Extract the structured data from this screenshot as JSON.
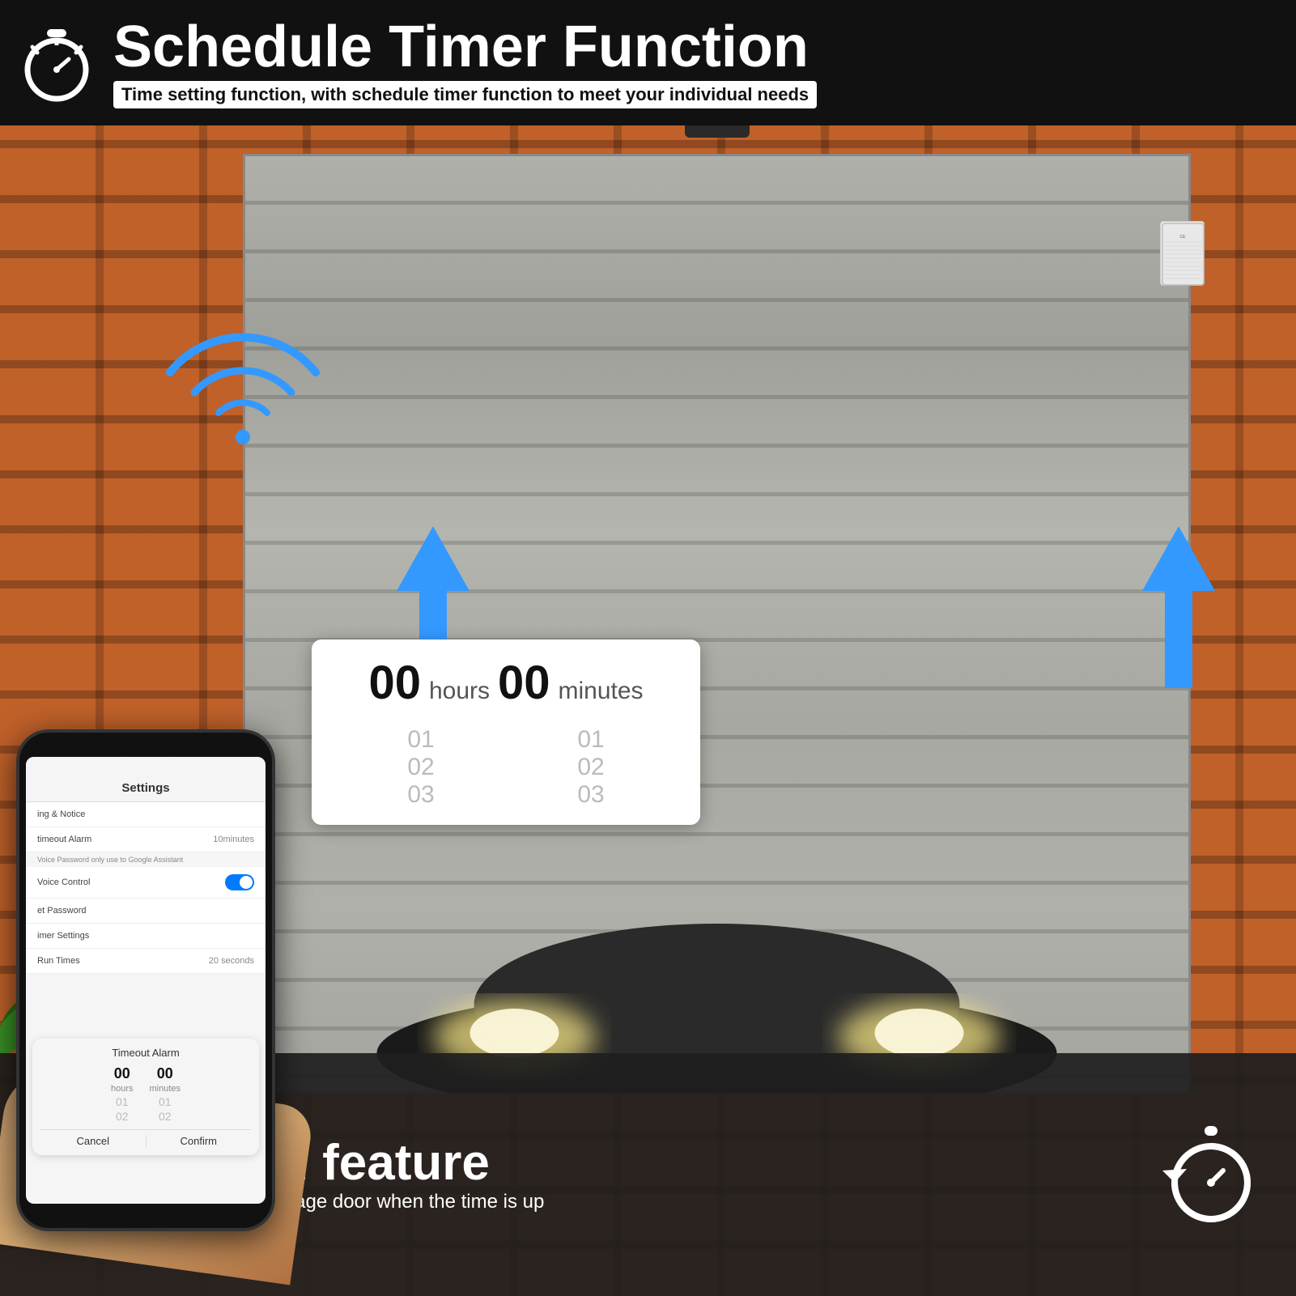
{
  "header": {
    "title": "Schedule Timer Function",
    "subtitle": "Time setting function, with schedule timer function to meet your individual needs"
  },
  "phone": {
    "screen_title": "Settings",
    "items": [
      {
        "label": "ing & Notice",
        "value": ""
      },
      {
        "label": "timeout Alarm",
        "value": "10minutes"
      },
      {
        "label": "Voice Password only use to Google Assistant",
        "value": ""
      },
      {
        "label": "Voice Control",
        "value": "toggle_on"
      },
      {
        "label": "et Password",
        "value": ""
      },
      {
        "label": "imer Settings",
        "value": ""
      },
      {
        "label": "Run Times",
        "value": "20 seconds"
      }
    ],
    "popup_title": "Timeout Alarm",
    "popup": {
      "hours_label": "hours",
      "minutes_label": "minutes",
      "hours_value": "00",
      "minutes_value": "00",
      "row1_h": "01",
      "row1_m": "01",
      "row2_h": "02",
      "row2_m": "02",
      "cancel_label": "Cancel",
      "confirm_label": "Confirm"
    }
  },
  "time_picker": {
    "hours_value": "00",
    "hours_unit": "hours",
    "minutes_value": "00",
    "minutes_unit": "minutes",
    "h_row1": "01",
    "h_row2": "02",
    "h_row3": "03",
    "m_row1": "01",
    "m_row2": "02",
    "m_row3": "03"
  },
  "bottom_banner": {
    "title": "Countdown feature",
    "subtitle": "will automatically close the garage door when the time is up"
  },
  "colors": {
    "accent_blue": "#3399ff",
    "header_bg": "#111111",
    "banner_bg": "#1e1e1e",
    "white": "#ffffff",
    "text_dark": "#111111"
  }
}
